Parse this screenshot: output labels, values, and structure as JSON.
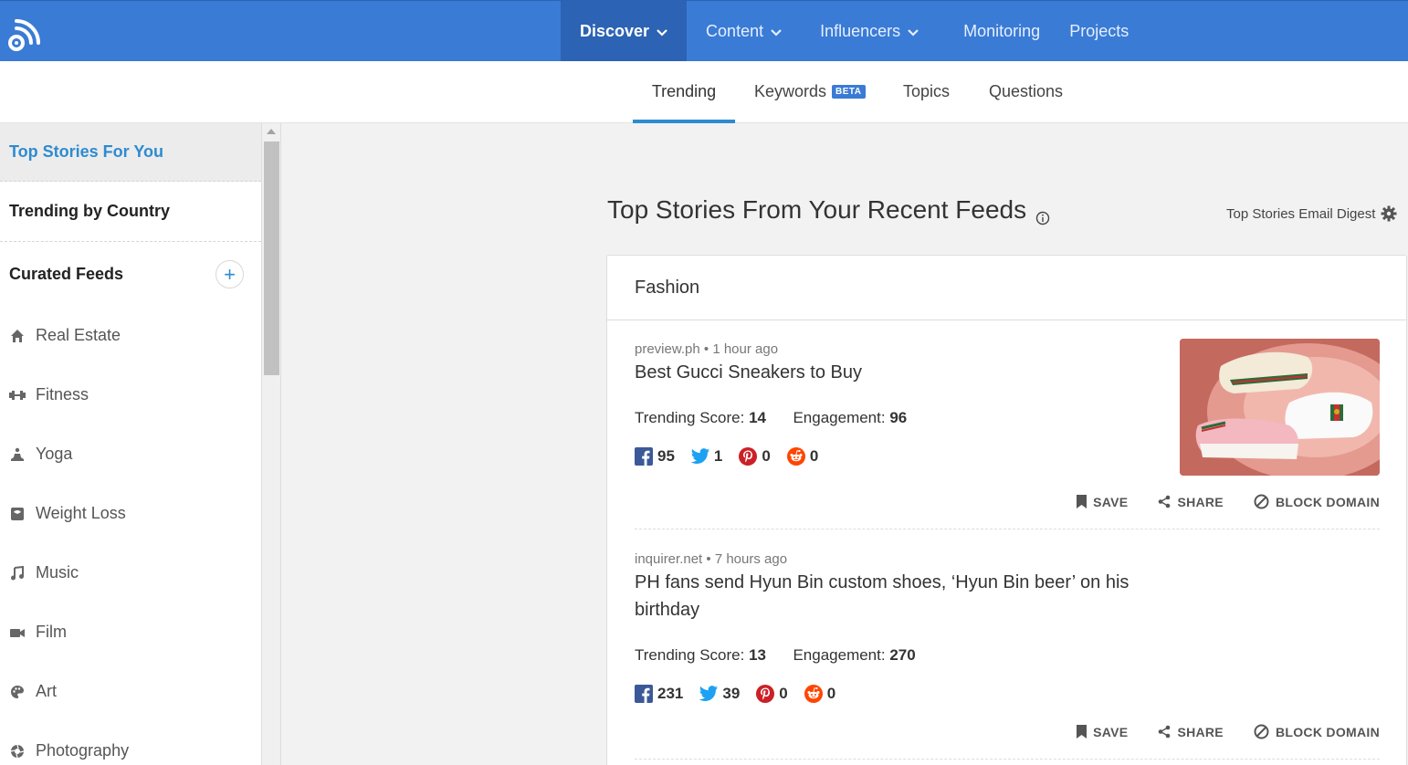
{
  "nav": {
    "items": [
      {
        "label": "Discover",
        "dropdown": true,
        "active": true
      },
      {
        "label": "Content",
        "dropdown": true
      },
      {
        "label": "Influencers",
        "dropdown": true
      },
      {
        "label": "Monitoring"
      },
      {
        "label": "Projects"
      }
    ]
  },
  "subtabs": {
    "trending": "Trending",
    "keywords": "Keywords",
    "keywords_badge": "BETA",
    "topics": "Topics",
    "questions": "Questions"
  },
  "sidebar": {
    "top_stories": "Top Stories For You",
    "trending_country": "Trending by Country",
    "curated_feeds": "Curated Feeds",
    "add_label": "+",
    "feeds": [
      {
        "label": "Real Estate",
        "icon": "home-icon"
      },
      {
        "label": "Fitness",
        "icon": "dumbbell-icon"
      },
      {
        "label": "Yoga",
        "icon": "yoga-icon"
      },
      {
        "label": "Weight Loss",
        "icon": "scale-icon"
      },
      {
        "label": "Music",
        "icon": "music-note-icon"
      },
      {
        "label": "Film",
        "icon": "video-camera-icon"
      },
      {
        "label": "Art",
        "icon": "palette-icon"
      },
      {
        "label": "Photography",
        "icon": "camera-aperture-icon"
      }
    ]
  },
  "main": {
    "title": "Top Stories From Your Recent Feeds",
    "digest_label": "Top Stories Email Digest",
    "card_title": "Fashion",
    "actions": {
      "save": "SAVE",
      "share": "SHARE",
      "block": "BLOCK DOMAIN"
    },
    "stories": [
      {
        "source": "preview.ph",
        "time": "1 hour ago",
        "title": "Best Gucci Sneakers to Buy",
        "trending_label": "Trending Score:",
        "trending_score": "14",
        "engagement_label": "Engagement:",
        "engagement": "96",
        "facebook": "95",
        "twitter": "1",
        "pinterest": "0",
        "reddit": "0"
      },
      {
        "source": "inquirer.net",
        "time": "7 hours ago",
        "title": "PH fans send Hyun Bin custom shoes, ‘Hyun Bin beer’ on his birthday",
        "trending_label": "Trending Score:",
        "trending_score": "13",
        "engagement_label": "Engagement:",
        "engagement": "270",
        "facebook": "231",
        "twitter": "39",
        "pinterest": "0",
        "reddit": "0"
      }
    ]
  },
  "colors": {
    "topbar": "#3a7bd5",
    "active_nav": "#2c63b4",
    "accent": "#2e8bcf",
    "facebook": "#3b5998",
    "twitter": "#1da1f2",
    "pinterest": "#cb2027",
    "reddit": "#ff4500"
  }
}
